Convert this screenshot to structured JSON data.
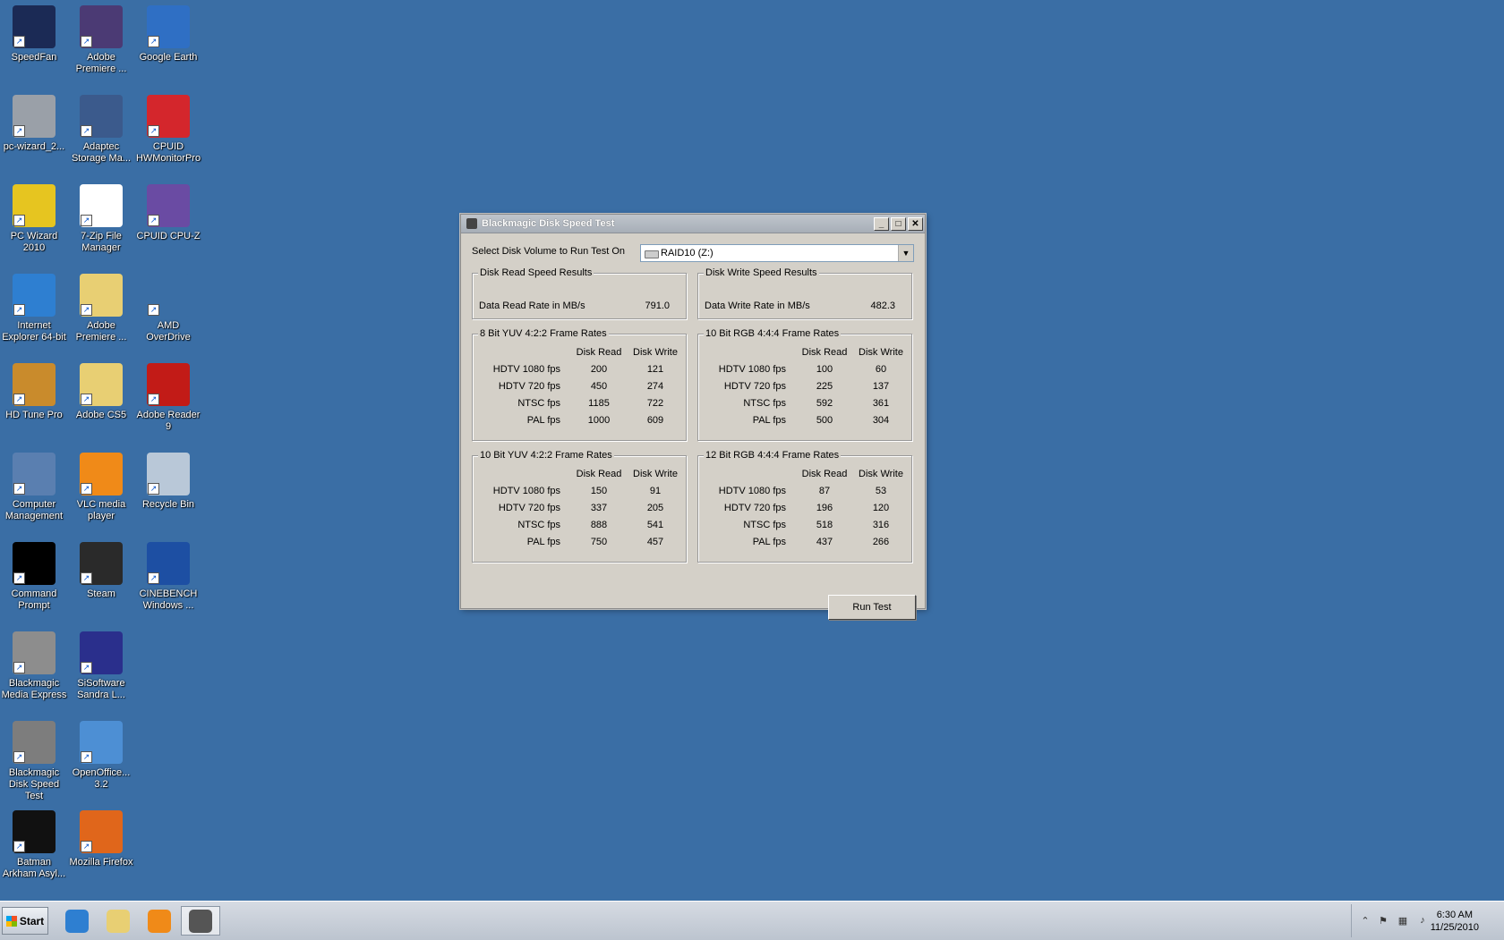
{
  "desktop_icons": [
    {
      "label": "SpeedFan",
      "icon": "fan-icon",
      "color": "#1b2a55"
    },
    {
      "label": "Adobe Premiere ...",
      "icon": "premiere-icon",
      "color": "#4b3a74"
    },
    {
      "label": "Google Earth",
      "icon": "globe-icon",
      "color": "#2f6fc4"
    },
    {
      "label": "pc-wizard_2...",
      "icon": "installer-icon",
      "color": "#9aa0a8"
    },
    {
      "label": "Adaptec Storage Ma...",
      "icon": "storage-icon",
      "color": "#3b5a8c"
    },
    {
      "label": "CPUID HWMonitorPro",
      "icon": "hwmonitor-icon",
      "color": "#d4262c"
    },
    {
      "label": "PC Wizard 2010",
      "icon": "wizard-icon",
      "color": "#e6c520"
    },
    {
      "label": "7-Zip File Manager",
      "icon": "7zip-icon",
      "color": "#ffffff"
    },
    {
      "label": "CPUID CPU-Z",
      "icon": "cpuz-icon",
      "color": "#6a4ba3"
    },
    {
      "label": "Internet Explorer 64-bit",
      "icon": "ie-icon",
      "color": "#2e7fd1"
    },
    {
      "label": "Adobe Premiere ...",
      "icon": "folder-icon",
      "color": "#e8cf73"
    },
    {
      "label": "AMD OverDrive",
      "icon": "amd-icon",
      "color": "#3a6ea5"
    },
    {
      "label": "HD Tune Pro",
      "icon": "hdtune-icon",
      "color": "#c98b2c"
    },
    {
      "label": "Adobe CS5",
      "icon": "folder-icon",
      "color": "#e8cf73"
    },
    {
      "label": "Adobe Reader 9",
      "icon": "reader-icon",
      "color": "#c21b17"
    },
    {
      "label": "Computer Management",
      "icon": "computer-management-icon",
      "color": "#5a7fb0"
    },
    {
      "label": "VLC media player",
      "icon": "vlc-icon",
      "color": "#f08a18"
    },
    {
      "label": "Recycle Bin",
      "icon": "recycle-bin-icon",
      "color": "#b9c8d8"
    },
    {
      "label": "Command Prompt",
      "icon": "terminal-icon",
      "color": "#000000"
    },
    {
      "label": "Steam",
      "icon": "steam-icon",
      "color": "#2a2a2a"
    },
    {
      "label": "CINEBENCH Windows ...",
      "icon": "cinebench-icon",
      "color": "#1d4fa3"
    },
    {
      "label": "Blackmagic Media Express",
      "icon": "film-reel-icon",
      "color": "#8d8d8d"
    },
    {
      "label": "SiSoftware Sandra L...",
      "icon": "sandra-icon",
      "color": "#2a2f8c"
    },
    {
      "label": "",
      "icon": "",
      "color": ""
    },
    {
      "label": "Blackmagic Disk Speed Test",
      "icon": "disk-speed-icon",
      "color": "#7d7d7d"
    },
    {
      "label": "OpenOffice... 3.2",
      "icon": "openoffice-icon",
      "color": "#4d8fd4"
    },
    {
      "label": "",
      "icon": "",
      "color": ""
    },
    {
      "label": "Batman Arkham Asyl...",
      "icon": "batman-icon",
      "color": "#111111"
    },
    {
      "label": "Mozilla Firefox",
      "icon": "firefox-icon",
      "color": "#e0661b"
    }
  ],
  "window": {
    "title": "Blackmagic Disk Speed Test",
    "select_label": "Select Disk Volume to Run Test On",
    "selected_volume": "RAID10 (Z:)",
    "read_group": {
      "legend": "Disk Read Speed Results",
      "label": "Data Read Rate in MB/s",
      "value": "791.0"
    },
    "write_group": {
      "legend": "Disk Write Speed Results",
      "label": "Data Write Rate in MB/s",
      "value": "482.3"
    },
    "col_read": "Disk Read",
    "col_write": "Disk Write",
    "tables": [
      {
        "legend": "8 Bit YUV 4:2:2 Frame Rates",
        "rows": [
          {
            "label": "HDTV 1080 fps",
            "read": "200",
            "write": "121"
          },
          {
            "label": "HDTV 720 fps",
            "read": "450",
            "write": "274"
          },
          {
            "label": "NTSC fps",
            "read": "1185",
            "write": "722"
          },
          {
            "label": "PAL fps",
            "read": "1000",
            "write": "609"
          }
        ]
      },
      {
        "legend": "10 Bit RGB 4:4:4 Frame Rates",
        "rows": [
          {
            "label": "HDTV 1080 fps",
            "read": "100",
            "write": "60"
          },
          {
            "label": "HDTV 720 fps",
            "read": "225",
            "write": "137"
          },
          {
            "label": "NTSC fps",
            "read": "592",
            "write": "361"
          },
          {
            "label": "PAL fps",
            "read": "500",
            "write": "304"
          }
        ]
      },
      {
        "legend": "10 Bit YUV 4:2:2 Frame Rates",
        "rows": [
          {
            "label": "HDTV 1080 fps",
            "read": "150",
            "write": "91"
          },
          {
            "label": "HDTV 720 fps",
            "read": "337",
            "write": "205"
          },
          {
            "label": "NTSC fps",
            "read": "888",
            "write": "541"
          },
          {
            "label": "PAL fps",
            "read": "750",
            "write": "457"
          }
        ]
      },
      {
        "legend": "12 Bit RGB 4:4:4 Frame Rates",
        "rows": [
          {
            "label": "HDTV 1080 fps",
            "read": "87",
            "write": "53"
          },
          {
            "label": "HDTV 720 fps",
            "read": "196",
            "write": "120"
          },
          {
            "label": "NTSC fps",
            "read": "518",
            "write": "316"
          },
          {
            "label": "PAL fps",
            "read": "437",
            "write": "266"
          }
        ]
      }
    ],
    "run_button": "Run Test"
  },
  "taskbar": {
    "start_label": "Start",
    "items": [
      {
        "icon": "ie-icon",
        "color": "#2e7fd1"
      },
      {
        "icon": "explorer-folder-icon",
        "color": "#e8cf73"
      },
      {
        "icon": "media-player-icon",
        "color": "#f08a18"
      },
      {
        "icon": "disk-speed-icon",
        "color": "#555555"
      }
    ],
    "clock_time": "6:30 AM",
    "clock_date": "11/25/2010"
  }
}
